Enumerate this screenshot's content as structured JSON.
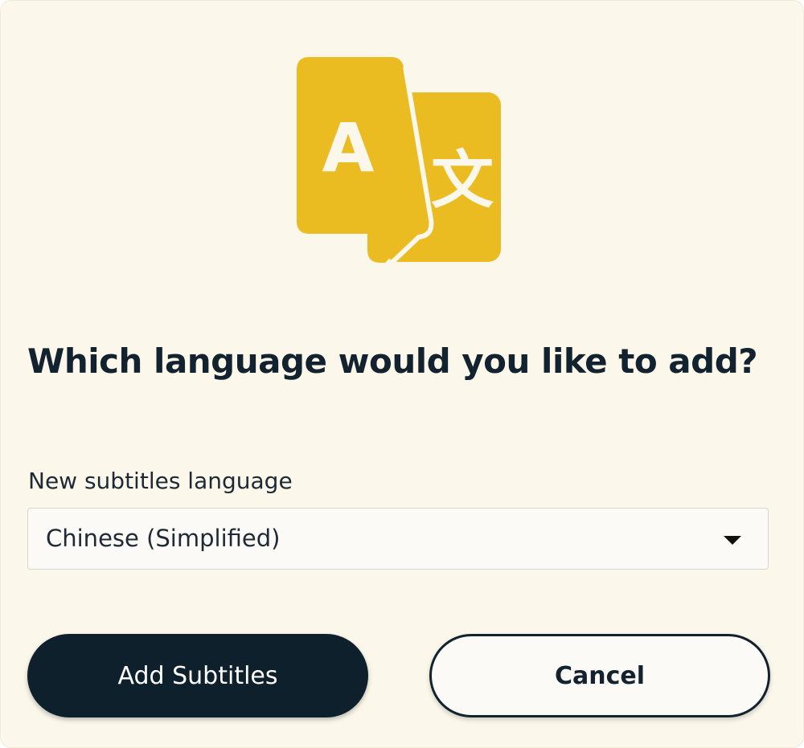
{
  "dialog": {
    "icon": "translate-icon",
    "icon_glyphs": [
      "A",
      "文"
    ],
    "title": "Which language would you like to add?",
    "field_label": "New subtitles language",
    "select_value": "Chinese (Simplified)",
    "primary_button": "Add Subtitles",
    "secondary_button": "Cancel"
  },
  "colors": {
    "background": "#fbf7ea",
    "accent": "#ebbb22",
    "primary_button": "#0f202d",
    "text": "#13222f"
  }
}
